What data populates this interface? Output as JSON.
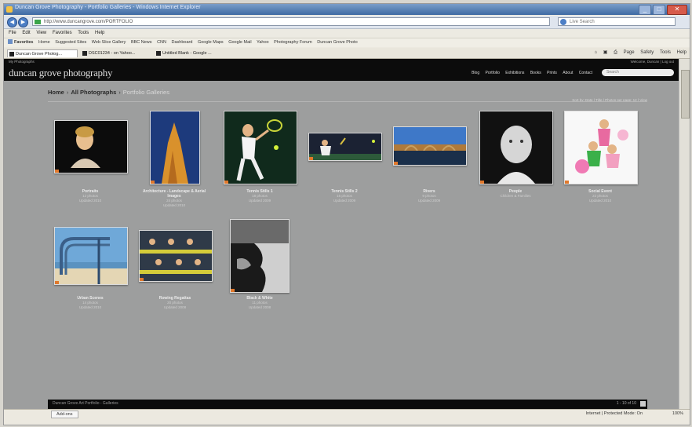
{
  "browser": {
    "title": "Duncan Grove Photography - Portfolio Galleries - Windows Internet Explorer",
    "address": "http://www.duncangrove.com/PORTFOLIO",
    "search_placeholder": "Live Search",
    "menu": [
      "File",
      "Edit",
      "View",
      "Favorites",
      "Tools",
      "Help"
    ],
    "toolbar1": [
      "Favorites",
      "Home",
      "Suggested Sites",
      "Web Slice Gallery",
      "BBC News",
      "CNN",
      "Dashboard",
      "Google Maps",
      "Google Mail",
      "Yahoo",
      "Photography Forum",
      "Duncan Grove Photo"
    ],
    "toolbar2": [
      "Favorites",
      "Suggested Sites",
      "Web Slice Gallery",
      "Photo blog",
      "Flickr",
      "Google News",
      "Google Docs",
      "Photography Blog",
      "Duncan's Web Site",
      "BBC Sport",
      "Weather",
      "Newsgroups"
    ],
    "tabs": [
      "Duncan Grove Photog...",
      "DSC01234 - on Yahoo...",
      "Untitled Blank - Google ..."
    ],
    "tool_icons": [
      "Page",
      "Safety",
      "Tools",
      "Help"
    ],
    "status_left": "Add-ons",
    "status_right": "Internet | Protected Mode: On",
    "zoom": "100%"
  },
  "site": {
    "top_left": "My Photographs",
    "top_right": "Welcome, Duncan | Log out",
    "logo": "duncan grove photography",
    "nav": [
      "Blog",
      "Portfolio",
      "Exhibitions",
      "Books",
      "Prints",
      "About",
      "Contact"
    ],
    "search_placeholder": "Search",
    "breadcrumb": [
      "Home",
      "All Photographs",
      "Portfolio Galleries"
    ],
    "sort_info": "Sort by: Date | Title | Photos per page: 12 | View",
    "bottom_left": "Duncan Grove Art Portfolio - Galleries",
    "bottom_right": "1 - 10 of 10"
  },
  "gallery": [
    {
      "title": "Portraits",
      "line1": "12 photos",
      "line2": "Updated 2010"
    },
    {
      "title": "Architecture - Landscape & Aerial Images",
      "line1": "24 photos",
      "line2": "Updated 2010"
    },
    {
      "title": "Tennis Stills 1",
      "line1": "18 photos",
      "line2": "Updated 2009"
    },
    {
      "title": "Tennis Stills 2",
      "line1": "16 photos",
      "line2": "Updated 2009"
    },
    {
      "title": "Rivers",
      "line1": "9 photos",
      "line2": "Updated 2009"
    },
    {
      "title": "People",
      "line1": "Children & Families",
      "line2": ""
    },
    {
      "title": "Social Event",
      "line1": "22 photos",
      "line2": "Updated 2010"
    },
    {
      "title": "Urban Scenes",
      "line1": "14 photos",
      "line2": "Updated 2010"
    },
    {
      "title": "Rowing Regattas",
      "line1": "20 photos",
      "line2": "Updated 2008"
    },
    {
      "title": "Black & White",
      "line1": "11 photos",
      "line2": "Updated 2008"
    }
  ],
  "colors": {
    "page_bg": "#9d9e9e",
    "header_bg": "#0c0c0c",
    "accent": "#e0782c"
  }
}
